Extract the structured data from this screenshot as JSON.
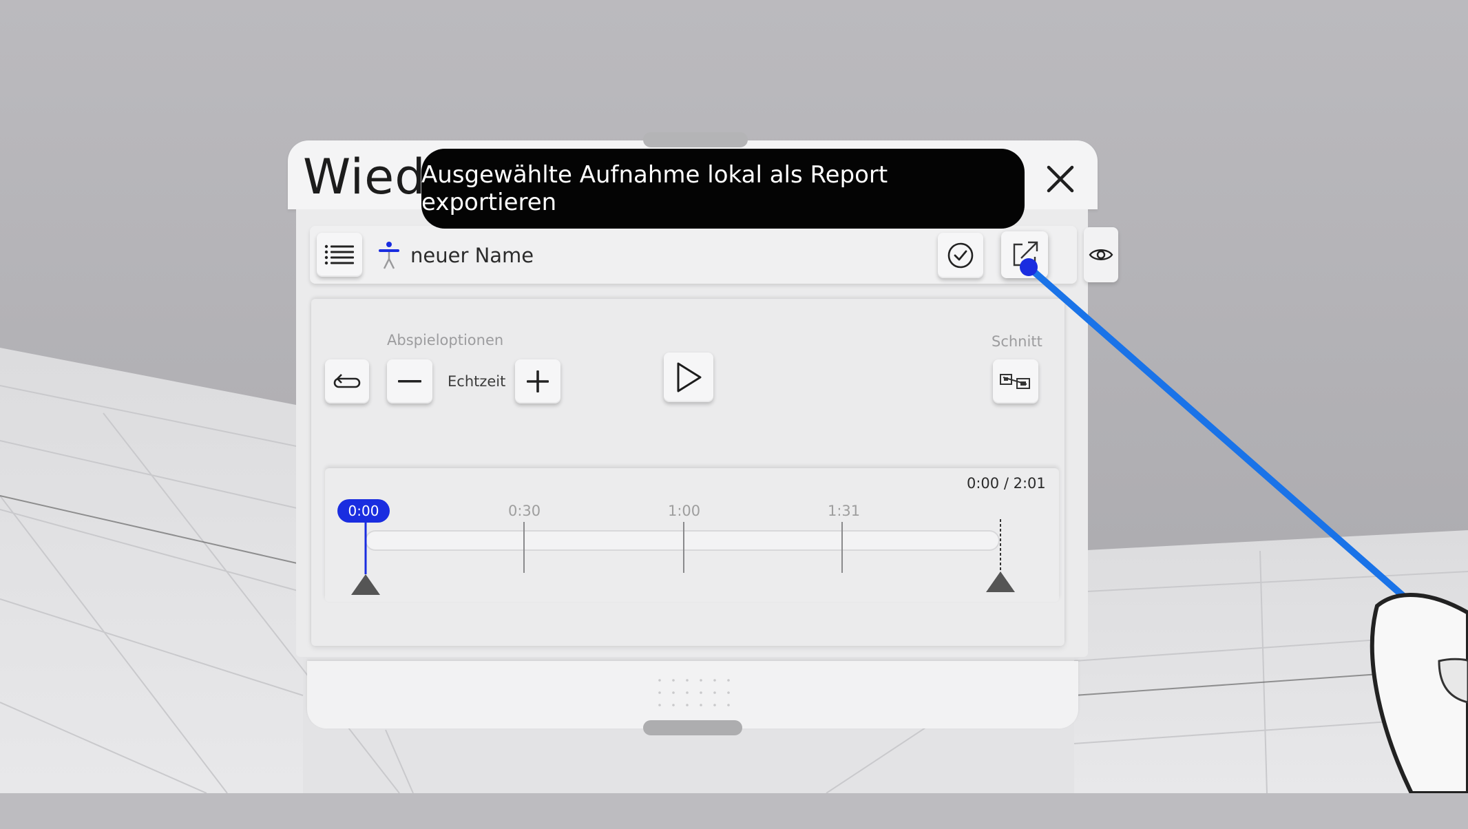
{
  "window": {
    "title_partial": "Wiede",
    "close_icon": "close-icon"
  },
  "tooltip": {
    "text": "Ausgewählte Aufnahme lokal als Report exportieren"
  },
  "toolbar": {
    "list_icon": "list-icon",
    "figure_icon": "human-figure-icon",
    "recording_name": "neuer Name",
    "confirm_icon": "checkmark-circle-icon",
    "export_icon": "export-arrow-icon",
    "eye_icon": "eye-icon"
  },
  "playback": {
    "section_label": "Abspieloptionen",
    "speed_label": "Echtzeit",
    "loop_icon": "loop-icon",
    "minus_icon": "minus-icon",
    "plus_icon": "plus-icon",
    "play_icon": "play-icon"
  },
  "cut": {
    "section_label": "Schnitt",
    "cut_icon": "cut-icon"
  },
  "timeline": {
    "current_time": "0:00",
    "time_display": "0:00 / 2:01",
    "ticks": [
      "0:30",
      "1:00",
      "1:31"
    ],
    "position_fraction": 0.0,
    "accent_color": "#1a2de0"
  },
  "pointer": {
    "ray_color": "#1a73e8"
  }
}
